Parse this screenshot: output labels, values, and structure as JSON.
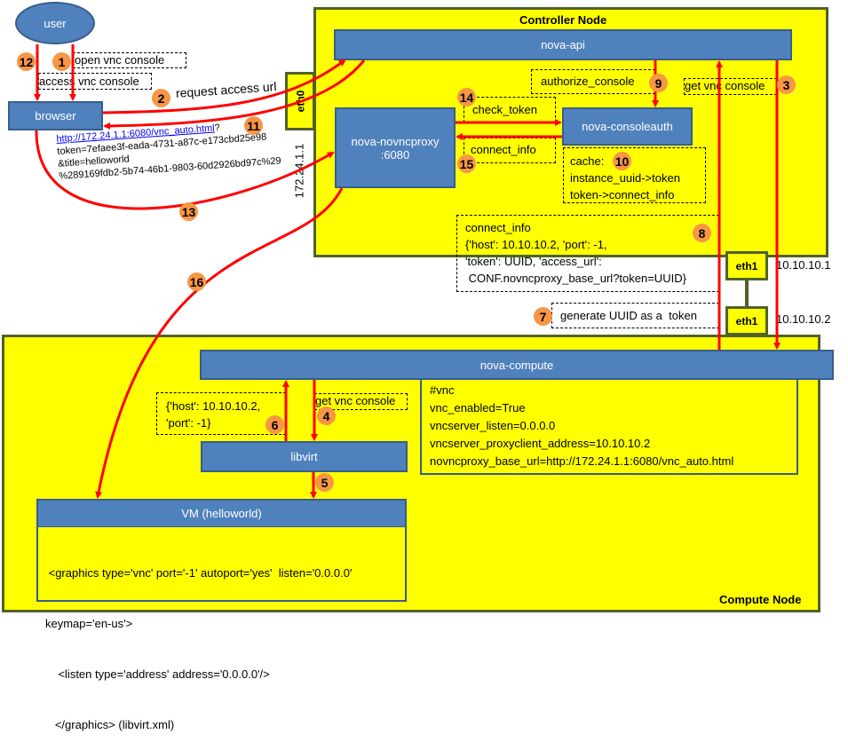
{
  "nodes": {
    "controller_title": "Controller Node",
    "compute_title": "Compute Node"
  },
  "components": {
    "user": "user",
    "browser": "browser",
    "nova_api": "nova-api",
    "nova_novncproxy_line1": "nova-novncproxy",
    "nova_novncproxy_line2": ":6080",
    "nova_consoleauth": "nova-consoleauth",
    "nova_compute": "nova-compute",
    "libvirt": "libvirt",
    "vm": "VM (helloworld)"
  },
  "interfaces": {
    "eth0": "eth0",
    "eth0_ip": "172.24.1.1",
    "controller_eth1": "eth1",
    "controller_eth1_ip": "10.10.10.1",
    "compute_eth1": "eth1",
    "compute_eth1_ip": "10.10.10.2"
  },
  "labels": {
    "open_vnc_console": "open vnc console",
    "access_vnc_console": "access vnc console",
    "request_access_url": "request access url",
    "authorize_console": "authorize_console",
    "get_vnc_console_controller": "get vnc console",
    "check_token": "check_token",
    "connect_info": "connect_info",
    "generate_uuid": "generate UUID as a  token",
    "get_vnc_console_compute": "get vnc console"
  },
  "access_url": {
    "link": "http://172.24.1.1:6080/vnc_auto.html",
    "suffix": "?",
    "line2": "token=7efaee3f-eada-4731-a87c-e173cbd25e98",
    "line3": "&title=helloworld",
    "line4": "%289169fdb2-5b74-46b1-9803-60d2926bd97c%29"
  },
  "cache_box": {
    "title": "cache:",
    "line1": "instance_uuid->token",
    "line2": "token->connect_info"
  },
  "connect_info_box": {
    "line1": "connect_info",
    "line2": "{'host': 10.10.10.2, 'port': -1,",
    "line3": "'token': UUID, 'access_url':",
    "line4": " CONF.novncproxy_base_url?token=UUID}"
  },
  "host_port_box": {
    "line1": "{'host': 10.10.10.2,",
    "line2": "'port': -1}"
  },
  "compute_config": [
    "#vnc",
    "vnc_enabled=True",
    "vncserver_listen=0.0.0.0",
    "vncserver_proxyclient_address=10.10.10.2",
    "novncproxy_base_url=http://172.24.1.1:6080/vnc_auto.html"
  ],
  "vm_xml": [
    " <graphics type='vnc' port='-1' autoport='yes'  listen='0.0.0.0'",
    "keymap='en-us'>",
    "    <listen type='address' address='0.0.0.0'/>",
    "   </graphics> (libvirt.xml)"
  ],
  "steps": [
    "1",
    "2",
    "3",
    "4",
    "5",
    "6",
    "7",
    "8",
    "9",
    "10",
    "11",
    "12",
    "13",
    "14",
    "15",
    "16"
  ],
  "colors": {
    "node_fill": "#ffff00",
    "node_border": "#4f6228",
    "component_fill": "#4f81bd",
    "arrow": "#ff0000",
    "badge": "#f79646",
    "link": "#0000ee"
  }
}
